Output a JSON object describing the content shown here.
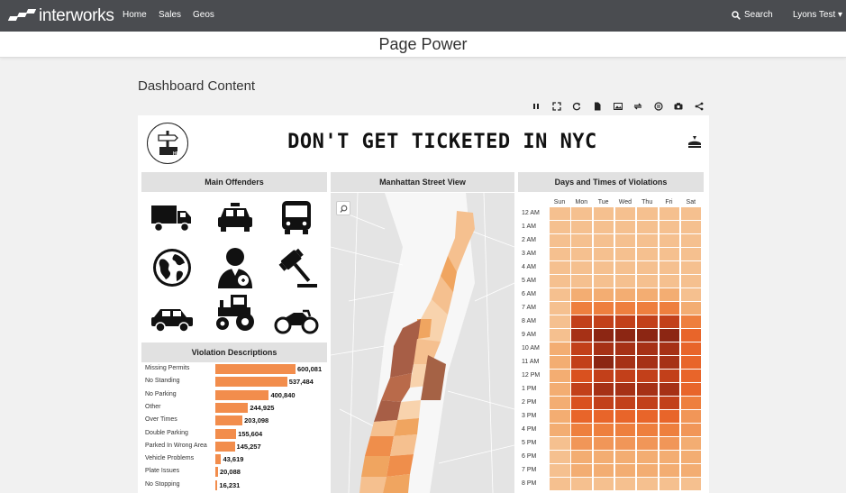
{
  "nav": {
    "brand": "interworks",
    "links": [
      "Home",
      "Sales",
      "Geos"
    ],
    "search_label": "Search",
    "user_label": "Lyons Test ▾"
  },
  "page": {
    "title": "Page Power",
    "section_heading": "Dashboard Content"
  },
  "toolbar": {
    "icons": [
      "pause-icon",
      "fullscreen-icon",
      "refresh-icon",
      "pdf-icon",
      "image-icon",
      "revert-icon",
      "data-icon",
      "snapshot-icon",
      "share-icon"
    ]
  },
  "dashboard": {
    "help_label": "HELP",
    "banner": "DON'T GET TICKETED IN NYC",
    "offenders_title": "Main Offenders",
    "offender_icons": [
      "truck-icon",
      "taxi-icon",
      "bus-icon",
      "globe-icon",
      "doctor-icon",
      "gavel-icon",
      "car-icon",
      "tractor-icon",
      "motorcycle-icon"
    ],
    "violations_title": "Violation Descriptions",
    "map_title": "Manhattan Street View",
    "heatmap_title": "Days and Times of Violations",
    "colors": {
      "bar": "#f28d4c",
      "header_bg": "#e1e1e1",
      "nav_bg": "#4a4c50"
    }
  },
  "chart_data": [
    {
      "type": "bar",
      "title": "Violation Descriptions",
      "categories": [
        "Missing Permits",
        "No Standing",
        "No Parking",
        "Other",
        "Over Times",
        "Double Parking",
        "Parked In Wrong Area",
        "Vehicle Problems",
        "Plate Issues",
        "No Stopping"
      ],
      "values": [
        600081,
        537484,
        400840,
        244925,
        203098,
        155604,
        145257,
        43619,
        20088,
        16231
      ],
      "labels": [
        "600,081",
        "537,484",
        "400,840",
        "244,925",
        "203,098",
        "155,604",
        "145,257",
        "43,619",
        "20,088",
        "16,231"
      ]
    },
    {
      "type": "heatmap",
      "title": "Days and Times of Violations",
      "x": [
        "Sun",
        "Mon",
        "Tue",
        "Wed",
        "Thu",
        "Fri",
        "Sat"
      ],
      "y": [
        "12 AM",
        "1 AM",
        "2 AM",
        "3 AM",
        "4 AM",
        "5 AM",
        "6 AM",
        "7 AM",
        "8 AM",
        "9 AM",
        "10 AM",
        "11 AM",
        "12 PM",
        "1 PM",
        "2 PM",
        "3 PM",
        "4 PM",
        "5 PM",
        "6 PM",
        "7 PM",
        "8 PM"
      ],
      "values": [
        [
          1,
          1,
          1,
          1,
          1,
          1,
          1
        ],
        [
          1,
          1,
          1,
          1,
          1,
          1,
          1
        ],
        [
          1,
          1,
          1,
          1,
          1,
          1,
          1
        ],
        [
          1,
          1,
          1,
          1,
          1,
          1,
          1
        ],
        [
          1,
          1,
          1,
          1,
          1,
          1,
          1
        ],
        [
          1,
          1,
          1,
          1,
          1,
          1,
          1
        ],
        [
          1,
          2,
          2,
          2,
          2,
          2,
          1
        ],
        [
          1,
          4,
          4,
          4,
          4,
          4,
          2
        ],
        [
          1,
          7,
          7,
          7,
          7,
          7,
          4
        ],
        [
          1,
          8,
          9,
          9,
          9,
          9,
          5
        ],
        [
          2,
          7,
          8,
          8,
          8,
          8,
          5
        ],
        [
          2,
          7,
          9,
          8,
          8,
          8,
          5
        ],
        [
          2,
          6,
          7,
          7,
          7,
          7,
          5
        ],
        [
          2,
          7,
          8,
          8,
          8,
          8,
          5
        ],
        [
          2,
          6,
          7,
          7,
          7,
          7,
          4
        ],
        [
          2,
          5,
          5,
          5,
          5,
          5,
          3
        ],
        [
          2,
          4,
          4,
          4,
          4,
          4,
          3
        ],
        [
          1,
          3,
          3,
          3,
          3,
          3,
          2
        ],
        [
          1,
          2,
          2,
          2,
          2,
          2,
          2
        ],
        [
          1,
          2,
          2,
          2,
          2,
          2,
          2
        ],
        [
          1,
          1,
          1,
          1,
          1,
          1,
          1
        ]
      ]
    }
  ]
}
